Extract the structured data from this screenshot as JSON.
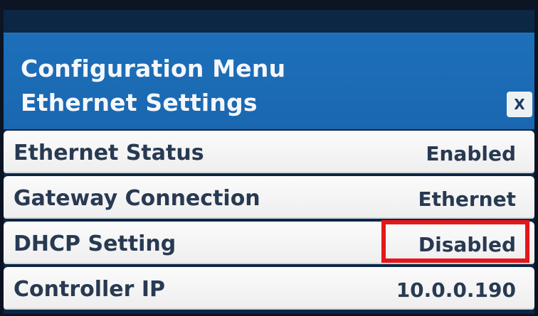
{
  "header": {
    "title_line1": "Configuration Menu",
    "title_line2": "Ethernet Settings",
    "close_label": "X"
  },
  "rows": [
    {
      "label": "Ethernet Status",
      "value": "Enabled"
    },
    {
      "label": "Gateway Connection",
      "value": "Ethernet"
    },
    {
      "label": "DHCP Setting",
      "value": "Disabled"
    },
    {
      "label": "Controller IP",
      "value": "10.0.0.190"
    }
  ],
  "annotation": {
    "highlighted_item": "DHCP Setting",
    "highlight_color": "#e5171c"
  },
  "colors": {
    "header_blue": "#1d6fba",
    "row_background": "#f3f3f3",
    "text_dark": "#283a52"
  }
}
